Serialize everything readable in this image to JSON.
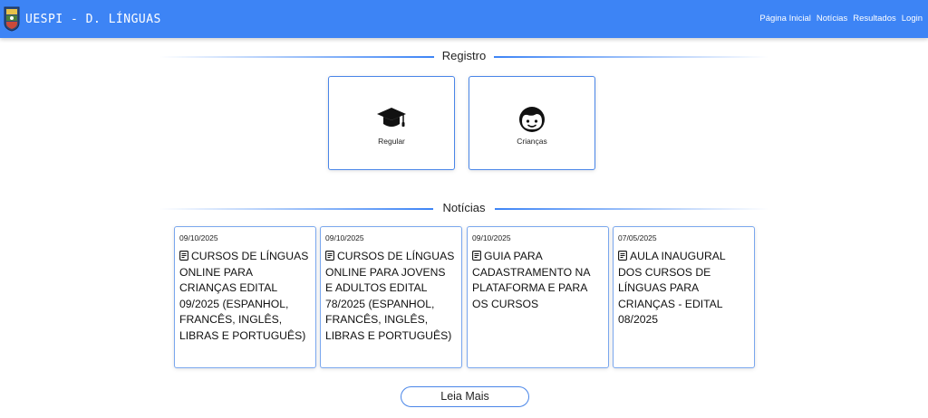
{
  "header": {
    "title": "UESPI - D. LÍNGUAS",
    "logo_icon": "uespi-logo",
    "nav": [
      {
        "label": "Página Inicial"
      },
      {
        "label": "Notícias"
      },
      {
        "label": "Resultados"
      },
      {
        "label": "Login"
      }
    ]
  },
  "registro": {
    "title": "Registro",
    "cards": [
      {
        "label": "Regular",
        "icon": "graduation-cap-icon"
      },
      {
        "label": "Crianças",
        "icon": "child-face-icon"
      }
    ]
  },
  "noticias": {
    "title": "Notícias",
    "items": [
      {
        "date": "09/10/2025",
        "title": "CURSOS DE LÍNGUAS ONLINE PARA CRIANÇAS EDITAL 09/2025 (ESPANHOL, FRANCÊS, INGLÊS, LIBRAS E PORTUGUÊS)"
      },
      {
        "date": "09/10/2025",
        "title": "CURSOS DE LÍNGUAS ONLINE PARA JOVENS E ADULTOS EDITAL 78/2025 (ESPANHOL, FRANCÊS, INGLÊS, LIBRAS E PORTUGUÊS)"
      },
      {
        "date": "09/10/2025",
        "title": "GUIA PARA CADASTRAMENTO NA PLATAFORMA E PARA OS CURSOS"
      },
      {
        "date": "07/05/2025",
        "title": "AULA INAUGURAL DOS CURSOS DE LÍNGUAS PARA CRIANÇAS - EDITAL 08/2025"
      }
    ],
    "more_label": "Leia Mais"
  },
  "colors": {
    "navbar": "#3d84f5",
    "card_border": "#4a86e8"
  }
}
